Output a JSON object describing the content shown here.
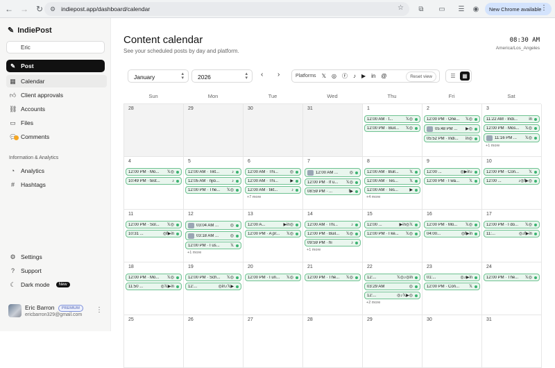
{
  "browser": {
    "url": "indiepost.app/dashboard/calendar",
    "update_label": "New Chrome available"
  },
  "sidebar": {
    "app_name": "IndiePost",
    "workspace": "Eric",
    "post_label": "Post",
    "nav": [
      {
        "label": "Calendar",
        "icon": "calendar-icon",
        "active": true
      },
      {
        "label": "Client approvals",
        "icon": "thumbs-up-icon"
      },
      {
        "label": "Accounts",
        "icon": "link-icon"
      },
      {
        "label": "Files",
        "icon": "folder-icon"
      },
      {
        "label": "Comments",
        "icon": "comment-icon"
      }
    ],
    "section_label": "Information & Analytics",
    "nav2": [
      {
        "label": "Analytics",
        "icon": "chart-icon"
      },
      {
        "label": "Hashtags",
        "icon": "hashtag-icon"
      }
    ],
    "bottom": [
      {
        "label": "Settings",
        "icon": "gear-icon"
      },
      {
        "label": "Support",
        "icon": "question-icon"
      },
      {
        "label": "Dark mode",
        "icon": "moon-icon",
        "badge": "New"
      }
    ],
    "user": {
      "name": "Eric Barron",
      "plan": "PREMIUM",
      "email": "ericbarron329@gmail.com"
    }
  },
  "header": {
    "title": "Content calendar",
    "subtitle": "See your scheduled posts by day and platform.",
    "clock": "08:30 AM",
    "timezone": "America/Los_Angeles"
  },
  "toolbar": {
    "month": "January",
    "year": "2026",
    "platforms_label": "Platforms",
    "platform_icons": [
      "x-icon",
      "instagram-icon",
      "facebook-icon",
      "tiktok-icon",
      "youtube-icon",
      "linkedin-icon",
      "threads-icon"
    ],
    "reset_label": "Reset view"
  },
  "calendar": {
    "weekdays": [
      "Sun",
      "Mon",
      "Tue",
      "Wed",
      "Thu",
      "Fri",
      "Sat"
    ],
    "weeks": [
      [
        {
          "day": "28",
          "muted": true,
          "posts": []
        },
        {
          "day": "29",
          "muted": true,
          "posts": []
        },
        {
          "day": "30",
          "muted": true,
          "posts": []
        },
        {
          "day": "31",
          "muted": true,
          "posts": []
        },
        {
          "day": "1",
          "posts": [
            {
              "text": "12:00 AM · t...",
              "icons": "𝕏◎"
            },
            {
              "text": "12:00 PM · Buil...",
              "icons": "𝕏◎"
            }
          ]
        },
        {
          "day": "2",
          "posts": [
            {
              "text": "12:00 PM · One...",
              "icons": "𝕏◎"
            },
            {
              "text": "05:48 PM ...",
              "icons": "▶◎",
              "thumb": true
            },
            {
              "text": "05:52 PM · Indi...",
              "icons": "in◎"
            }
          ]
        },
        {
          "day": "3",
          "posts": [
            {
              "text": "11:22 AM · Indi...",
              "icons": "in"
            },
            {
              "text": "12:00 PM · Mos...",
              "icons": "𝕏◎"
            },
            {
              "text": "11:16 PM ...",
              "icons": "𝕏◎",
              "thumb": true
            }
          ],
          "more": "+1 more"
        }
      ],
      [
        {
          "day": "4",
          "posts": [
            {
              "text": "12:00 PM · Mo...",
              "icons": "𝕏◎"
            },
            {
              "text": "10:49 PM · test...",
              "icons": "♪"
            }
          ]
        },
        {
          "day": "5",
          "posts": [
            {
              "text": "12:00 AM · Tikt...",
              "icons": "♪"
            },
            {
              "text": "12:05 AM · njio...",
              "icons": "♪"
            },
            {
              "text": "12:00 PM · The...",
              "icons": "𝕏◎"
            }
          ]
        },
        {
          "day": "6",
          "posts": [
            {
              "text": "12:00 AM · Thi...",
              "icons": "◎"
            },
            {
              "text": "12:00 AM · Thi...",
              "icons": "▶"
            },
            {
              "text": "12:00 AM · tikt...",
              "icons": "♪"
            }
          ],
          "more": "+7 more"
        },
        {
          "day": "7",
          "posts": [
            {
              "text": "12:00 AM ...",
              "icons": "◎",
              "thumb": true
            },
            {
              "text": "12:00 PM · If u...",
              "icons": "𝕏◎"
            },
            {
              "text": "08:59 PM · ...",
              "icons": "f▶"
            }
          ]
        },
        {
          "day": "8",
          "posts": [
            {
              "text": "12:00 AM · Buil...",
              "icons": "𝕏"
            },
            {
              "text": "12:00 AM · Tes...",
              "icons": "𝕏"
            },
            {
              "text": "12:00 AM · Tes...",
              "icons": "▶"
            }
          ],
          "more": "+4 more"
        },
        {
          "day": "9",
          "posts": [
            {
              "text": "12:00 ...",
              "icons": "◎▶in♪"
            },
            {
              "text": "12:00 PM · I wa...",
              "icons": "𝕏"
            }
          ]
        },
        {
          "day": "10",
          "posts": [
            {
              "text": "12:00 PM · Con...",
              "icons": "𝕏"
            },
            {
              "text": "12:00 ...",
              "icons": "♪◎f▶◎"
            }
          ]
        }
      ],
      [
        {
          "day": "11",
          "posts": [
            {
              "text": "12:00 PM · Sol...",
              "icons": "𝕏◎"
            },
            {
              "text": "10:31 ...",
              "icons": "◎f▶in"
            }
          ]
        },
        {
          "day": "12",
          "posts": [
            {
              "text": "03:04 AM ...",
              "icons": "◎",
              "thumb": true
            },
            {
              "text": "03:18 AM ...",
              "icons": "◎",
              "thumb": true
            },
            {
              "text": "12:00 PM · I us...",
              "icons": "𝕏"
            }
          ],
          "more": "+1 more"
        },
        {
          "day": "13",
          "posts": [
            {
              "text": "12:00 A...",
              "icons": "▶in◎"
            },
            {
              "text": "12:00 PM · A pr...",
              "icons": "𝕏◎"
            }
          ]
        },
        {
          "day": "14",
          "posts": [
            {
              "text": "12:00 AM · Thi...",
              "icons": "♪"
            },
            {
              "text": "12:00 PM · Buil...",
              "icons": "𝕏◎"
            },
            {
              "text": "09:59 PM · hi",
              "icons": "♪"
            }
          ],
          "more": "+1 more"
        },
        {
          "day": "15",
          "posts": [
            {
              "text": "12:00 ...",
              "icons": "▶in◎𝕏"
            },
            {
              "text": "12:00 PM · I ke...",
              "icons": "𝕏◎"
            }
          ]
        },
        {
          "day": "16",
          "posts": [
            {
              "text": "12:00 PM · Mo...",
              "icons": "𝕏◎"
            },
            {
              "text": "04:00...",
              "icons": "◎f▶in"
            }
          ]
        },
        {
          "day": "17",
          "posts": [
            {
              "text": "12:00 PM · I do...",
              "icons": "𝕏◎"
            },
            {
              "text": "11:...",
              "icons": "◎♪f▶in"
            }
          ]
        }
      ],
      [
        {
          "day": "18",
          "posts": [
            {
              "text": "12:00 PM · Mo...",
              "icons": "𝕏◎"
            },
            {
              "text": "11:50 ...",
              "icons": "◎𝕏▶in"
            }
          ]
        },
        {
          "day": "19",
          "posts": [
            {
              "text": "12:00 PM · Sch...",
              "icons": "𝕏◎"
            },
            {
              "text": "12:...",
              "icons": "◎in♪𝕏▶"
            }
          ]
        },
        {
          "day": "20",
          "posts": [
            {
              "text": "12:00 PM · I un...",
              "icons": "𝕏◎"
            }
          ]
        },
        {
          "day": "21",
          "posts": [
            {
              "text": "12:00 PM · The...",
              "icons": "𝕏◎"
            }
          ]
        },
        {
          "day": "22",
          "posts": [
            {
              "text": "12:...",
              "icons": "𝕏◎♪◎in"
            },
            {
              "text": "03:29 AM",
              "icons": "◎"
            },
            {
              "text": "12:...",
              "icons": "◎♪𝕏▶◎"
            }
          ],
          "more": "+2 more"
        },
        {
          "day": "23",
          "posts": [
            {
              "text": "01:...",
              "icons": "◎♪▶in"
            },
            {
              "text": "12:00 PM · Con...",
              "icons": "𝕏"
            }
          ]
        },
        {
          "day": "24",
          "posts": [
            {
              "text": "12:00 PM · The...",
              "icons": "𝕏◎"
            }
          ]
        }
      ],
      [
        {
          "day": "25",
          "posts": []
        },
        {
          "day": "26",
          "posts": []
        },
        {
          "day": "27",
          "posts": []
        },
        {
          "day": "28",
          "posts": []
        },
        {
          "day": "29",
          "posts": []
        },
        {
          "day": "30",
          "posts": []
        },
        {
          "day": "31",
          "posts": []
        }
      ]
    ]
  },
  "colors": {
    "accent": "#111111",
    "chip_bg": "#e9f6ee",
    "chip_border": "#6dc190",
    "status_dot": "#3cb371"
  }
}
